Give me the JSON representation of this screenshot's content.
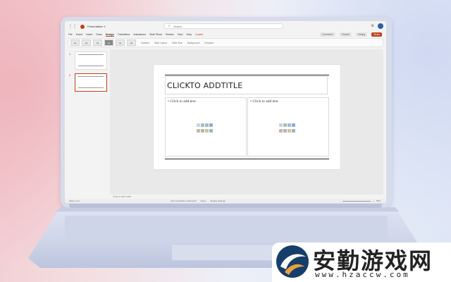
{
  "app": {
    "title": "Presentation 1",
    "search_placeholder": "Search",
    "editing_label": "Editing",
    "share_label": "Share",
    "comments_label": "Comments",
    "present_label": "Present"
  },
  "tabs": [
    {
      "label": "File"
    },
    {
      "label": "Home"
    },
    {
      "label": "Insert"
    },
    {
      "label": "Draw"
    },
    {
      "label": "Design",
      "active": true
    },
    {
      "label": "Transitions"
    },
    {
      "label": "Animations"
    },
    {
      "label": "Slide Show"
    },
    {
      "label": "Review"
    },
    {
      "label": "View"
    },
    {
      "label": "Help"
    },
    {
      "label": "Copilot"
    }
  ],
  "ribbon": {
    "themes": [
      "Aa",
      "Aa",
      "Aa",
      "Aa",
      "Aa",
      "Aa"
    ],
    "variants_label": "Variants",
    "items": [
      "Slide Layout",
      "Slide Size",
      "Background",
      "Designer"
    ]
  },
  "slides_panel": {
    "thumbs": [
      {
        "number": "1"
      },
      {
        "number": "2",
        "selected": true
      }
    ]
  },
  "slide": {
    "title": "CLICKTO ADDTITLE",
    "left_bullet": "Click to add text",
    "right_bullet": "Click to add text"
  },
  "notes_placeholder": "Click to add notes",
  "status": {
    "left": "Slide 2 of 2",
    "items": [
      "Give Feedback to Microsoft",
      "Notes",
      "Display Settings"
    ],
    "zoom": "59%"
  },
  "colors": {
    "accent": "#c43e1c",
    "avatar": "#2d5fa8",
    "watermark_logo": "#163e6b"
  },
  "watermark": {
    "cn": "安勤游戏网",
    "url": "www.hzaccw.com"
  }
}
